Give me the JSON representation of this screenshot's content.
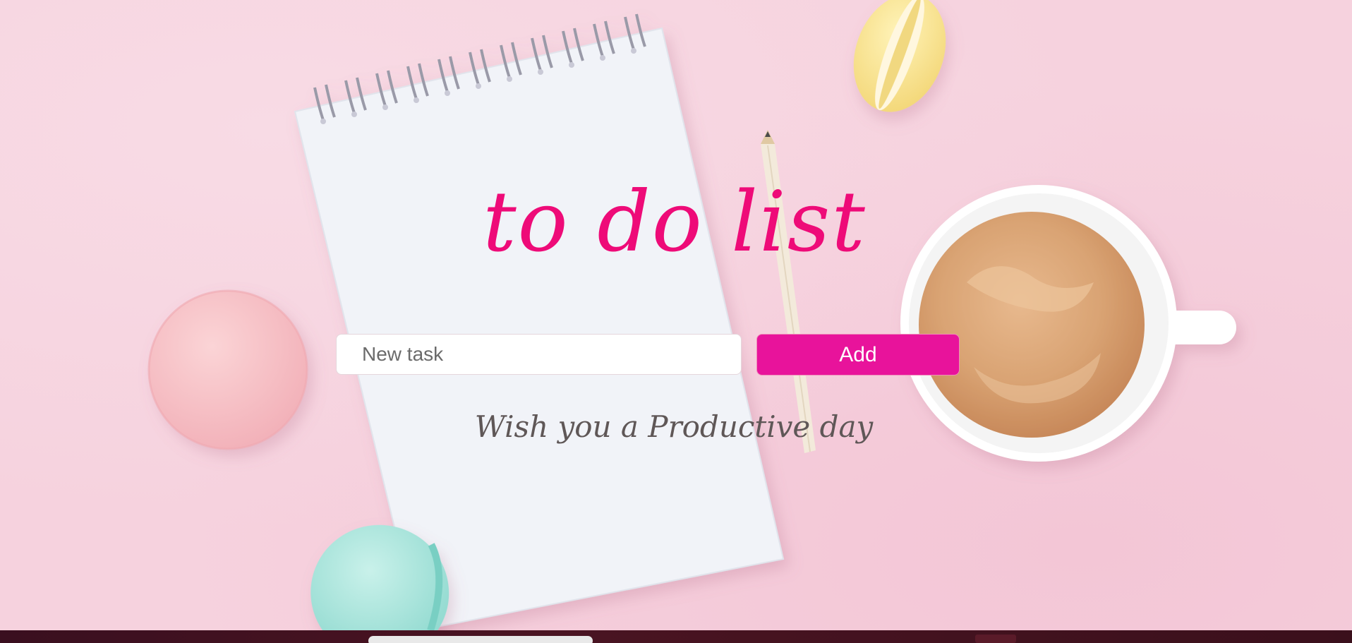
{
  "app": {
    "title": "to do list",
    "tagline": "Wish you a Productive day"
  },
  "form": {
    "input_placeholder": "New task",
    "input_value": "",
    "add_label": "Add"
  },
  "colors": {
    "title": "#ee0b78",
    "button": "#e8139b",
    "background": "#f6d2de",
    "tagline": "#5f5757"
  },
  "background_scene": {
    "icons": [
      "notepad-icon",
      "pencil-icon",
      "coffee-cup-icon",
      "macaron-pink-icon",
      "macaron-yellow-icon",
      "macaron-teal-icon"
    ]
  }
}
